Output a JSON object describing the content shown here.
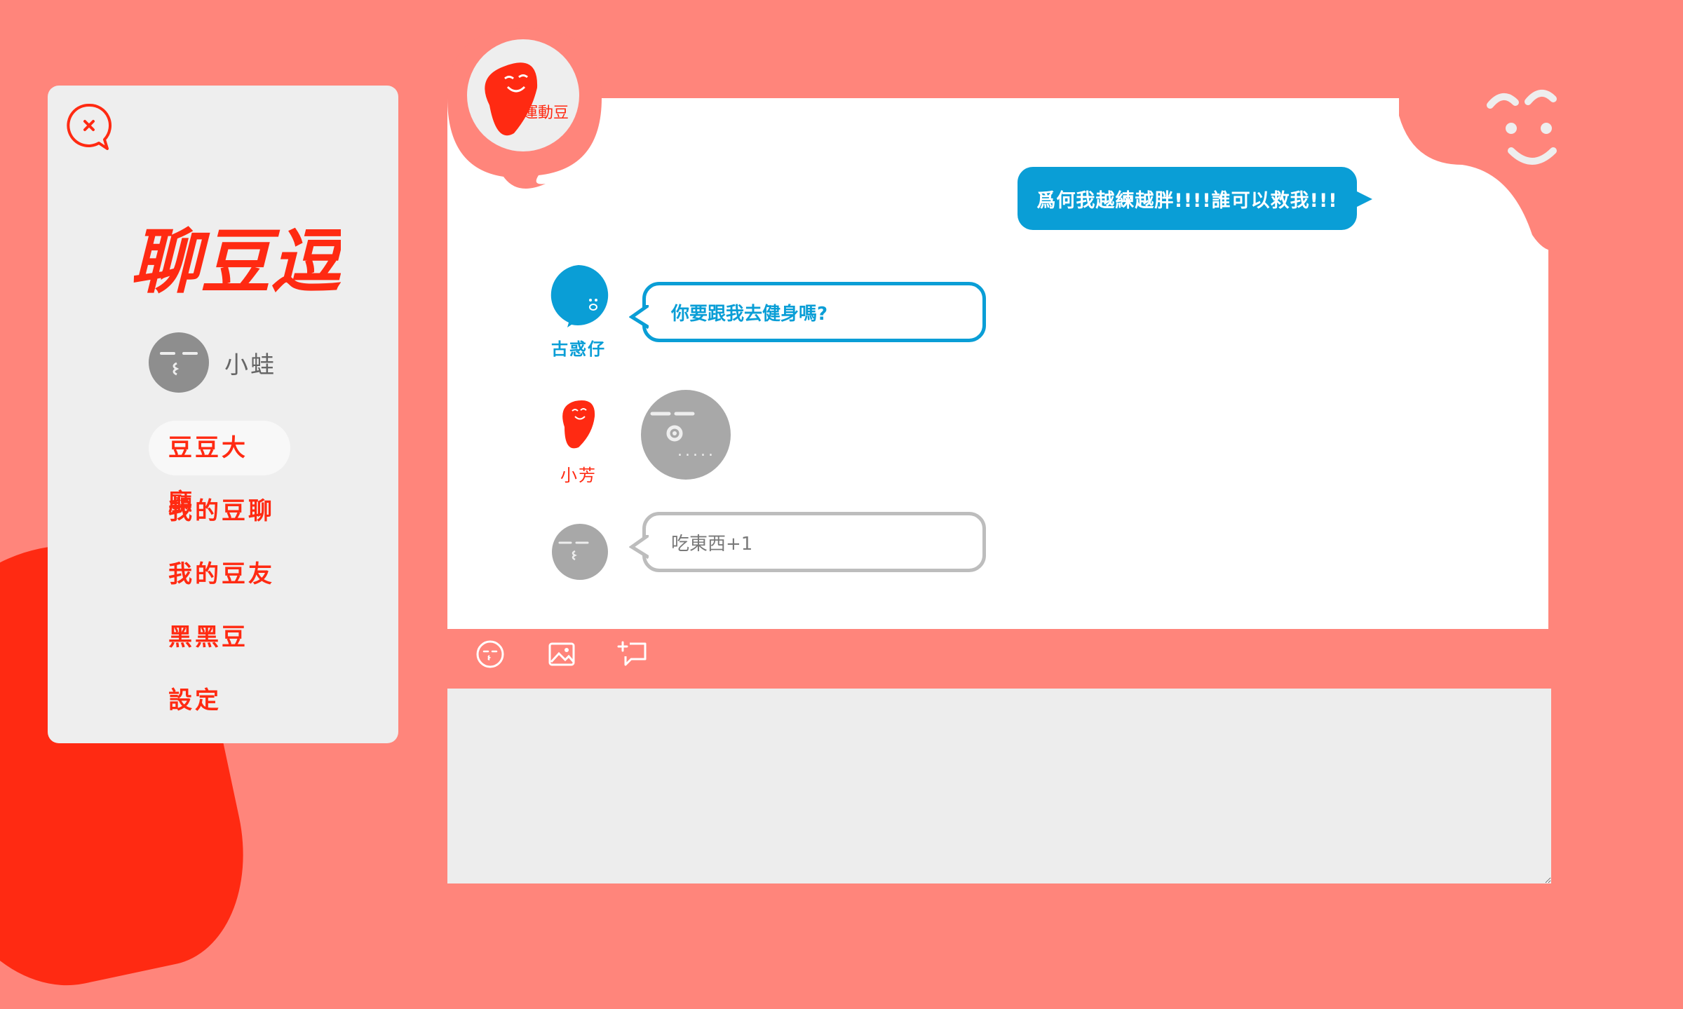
{
  "app": {
    "brand_name": "聊豆逗",
    "close_icon": "close-speech-icon",
    "colors": {
      "background": "#ff857b",
      "accent_red": "#ff2a12",
      "accent_blue": "#0a9ed6",
      "panel": "#eeeeee"
    }
  },
  "user": {
    "name": "小蛙",
    "avatar_icon": "gray-bean-face-icon"
  },
  "sidebar": {
    "items": [
      {
        "label": "豆豆大廳",
        "active": true
      },
      {
        "label": "我的豆聊",
        "active": false
      },
      {
        "label": "我的豆友",
        "active": false
      },
      {
        "label": "黑黑豆",
        "active": false
      },
      {
        "label": "設定",
        "active": false
      }
    ]
  },
  "room": {
    "name": "運動豆",
    "icon": "red-bean-smile-icon"
  },
  "messages": [
    {
      "sender": "me",
      "text": "爲何我越練越胖!!!!誰可以救我!!!"
    },
    {
      "sender": "古惑仔",
      "text": "你要跟我去健身嗎?",
      "avatar": "blue-bean-face-icon"
    },
    {
      "sender": "小芳",
      "text": ".....",
      "avatar": "red-bean-smile-icon",
      "content_icon": "gray-bean-sticker-icon"
    },
    {
      "sender": "",
      "text": "吃東西+1",
      "avatar": "gray-bean-face-icon"
    }
  ],
  "toolbar": {
    "icons": [
      "emoji-icon",
      "image-icon",
      "add-comment-icon"
    ]
  }
}
